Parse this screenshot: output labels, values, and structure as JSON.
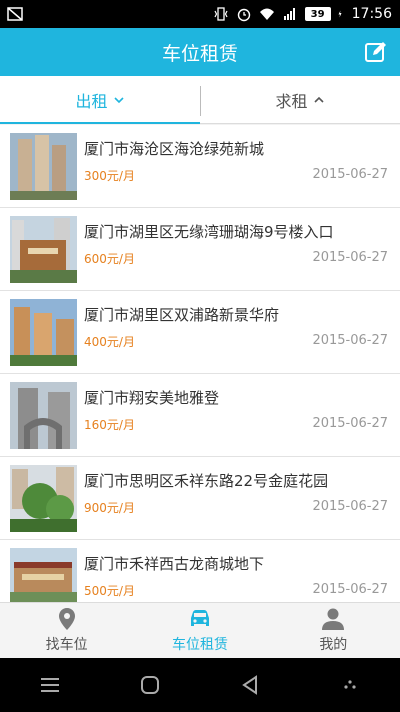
{
  "status_bar": {
    "battery": "39",
    "time": "17:56"
  },
  "header": {
    "title": "车位租赁"
  },
  "tabs": [
    {
      "label": "出租"
    },
    {
      "label": "求租"
    }
  ],
  "listings": [
    {
      "title": "厦门市海沧区海沧绿苑新城",
      "price": "300元/月",
      "date": "2015-06-27"
    },
    {
      "title": "厦门市湖里区无缘湾珊瑚海9号楼入口",
      "price": "600元/月",
      "date": "2015-06-27"
    },
    {
      "title": "厦门市湖里区双浦路新景华府",
      "price": "400元/月",
      "date": "2015-06-27"
    },
    {
      "title": "厦门市翔安美地雅登",
      "price": "160元/月",
      "date": "2015-06-27"
    },
    {
      "title": "厦门市思明区禾祥东路22号金庭花园",
      "price": "900元/月",
      "date": "2015-06-27"
    },
    {
      "title": "厦门市禾祥西古龙商城地下",
      "price": "500元/月",
      "date": "2015-06-27"
    }
  ],
  "bottom_nav": [
    {
      "label": "找车位"
    },
    {
      "label": "车位租赁"
    },
    {
      "label": "我的"
    }
  ],
  "colors": {
    "accent": "#1fb5de",
    "price": "#e6811f"
  }
}
